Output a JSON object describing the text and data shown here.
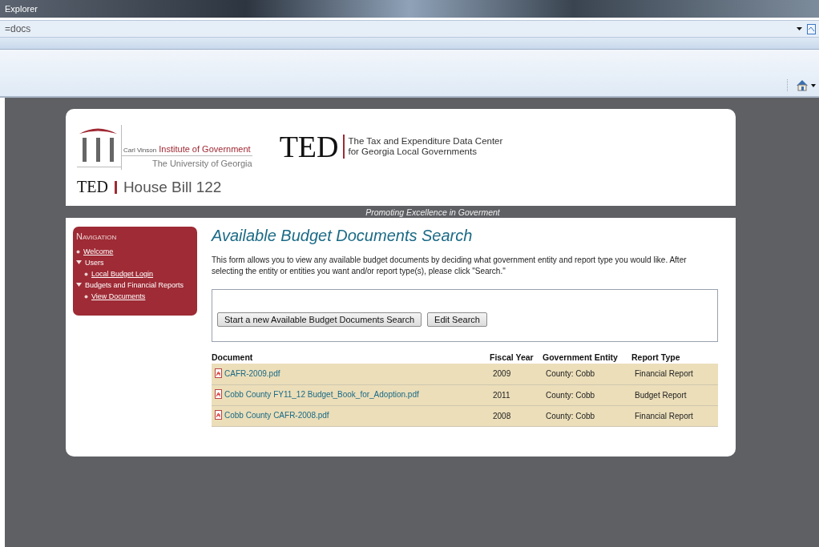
{
  "window": {
    "title": "Explorer"
  },
  "address_bar": {
    "value": "=docs"
  },
  "header": {
    "institute_prefix": "Carl Vinson",
    "institute_name": "Institute of Government",
    "university": "The University of Georgia",
    "ted_logo": "TED",
    "ted_line_1": "The Tax and Expenditure Data Center",
    "ted_line_2": "for Georgia Local Governments",
    "site_mark": "TED",
    "site_title": "House Bill 122",
    "tagline": "Promoting Excellence in Goverment"
  },
  "navigation": {
    "title": "Navigation",
    "items": [
      {
        "label": "Welcome",
        "link": true
      },
      {
        "label": "Users",
        "link": false,
        "expanded": true,
        "children": [
          {
            "label": "Local Budget Login",
            "link": true
          }
        ]
      },
      {
        "label": "Budgets and Financial Reports",
        "link": false,
        "expanded": true,
        "children": [
          {
            "label": "View Documents",
            "link": true
          }
        ]
      }
    ]
  },
  "content": {
    "title": "Available Budget Documents Search",
    "description": "This form allows you to view any available budget documents by deciding what government entity and report type you would like. After selecting the entity or entities you want and/or report type(s), please click \"Search.\"",
    "buttons": [
      "Start a new Available Budget Documents Search",
      "Edit Search"
    ]
  },
  "table": {
    "columns": [
      "Document",
      "Fiscal Year",
      "Government Entity",
      "Report Type"
    ],
    "rows": [
      {
        "document": "CAFR-2009.pdf",
        "fiscal_year": "2009",
        "entity": "County: Cobb",
        "report_type": "Financial Report"
      },
      {
        "document": "Cobb County FY11_12 Budget_Book_for_Adoption.pdf",
        "fiscal_year": "2011",
        "entity": "County: Cobb",
        "report_type": "Budget Report"
      },
      {
        "document": "Cobb County CAFR-2008.pdf",
        "fiscal_year": "2008",
        "entity": "County: Cobb",
        "report_type": "Financial Report"
      }
    ]
  }
}
